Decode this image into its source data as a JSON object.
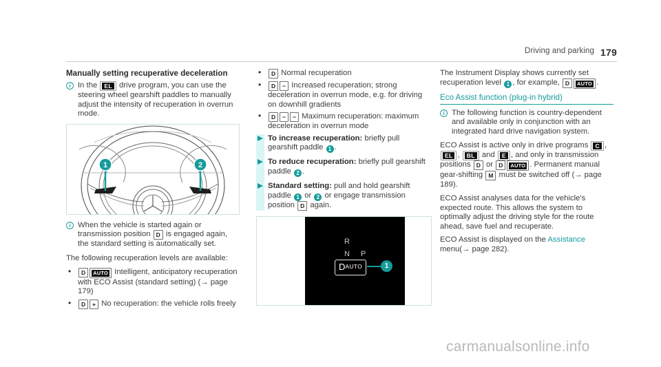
{
  "header": {
    "section_title": "Driving and parking",
    "page_number": "179"
  },
  "left_column": {
    "title": "Manually setting recuperative deceleration",
    "note1_prefix": "In the",
    "note1_badge": "EL",
    "note1_suffix": "drive program, you can use the steering wheel gearshift paddles to manually adjust the intensity of recuperation in overrun mode.",
    "figure_wheel": {
      "callout_1": "1",
      "callout_2": "2",
      "caption": "steering-wheel-gearshift-paddles"
    },
    "note2_prefix": "When the vehicle is started again or transmission position",
    "note2_badge": "D",
    "note2_suffix": "is engaged again, the standard setting is automatically set.",
    "levels_intro": "The following recuperation levels are available:",
    "level_items": [
      {
        "badge1": "D",
        "badge2": "AUTO",
        "text": "Intelligent, anticipatory recuperation with ECO Assist (standard setting)",
        "reference": "(→ page 179)"
      },
      {
        "badge1": "D",
        "badge2": "+",
        "text": "No recuperation: the vehicle rolls freely"
      }
    ]
  },
  "middle_column": {
    "level_items": [
      {
        "badges": [
          "D"
        ],
        "text": "Normal recuperation"
      },
      {
        "badges": [
          "D",
          "−"
        ],
        "text": "Increased recuperation; strong deceleration in overrun mode, e.g. for driving on downhill gradients"
      },
      {
        "badges": [
          "D",
          "−",
          "−"
        ],
        "text": "Maximum recuperation: maximum deceleration in overrun mode"
      }
    ],
    "actions": [
      {
        "lead": "To increase recuperation:",
        "text_before": " briefly pull gearshift paddle ",
        "callout": "1",
        "text_after": "."
      },
      {
        "lead": "To reduce recuperation:",
        "text_before": " briefly pull gearshift paddle ",
        "callout": "2",
        "text_after": "."
      },
      {
        "lead": "Standard setting:",
        "text_before": " pull and hold gearshift paddle ",
        "callout": "1",
        "text_mid": " or ",
        "callout2": "2",
        "text_after2": " or engage transmission position ",
        "badge": "D",
        "text_end": " again."
      }
    ],
    "figure_display": {
      "gear_r": "R",
      "gear_n": "N",
      "gear_p": "P",
      "selected_d": "D",
      "selected_auto": "AUTO",
      "callout_1": "1"
    }
  },
  "right_column": {
    "intro_before": "The Instrument Display shows currently set recuperation level ",
    "intro_callout": "1",
    "intro_middle": ", for example, ",
    "intro_badge1": "D",
    "intro_badge2": "AUTO",
    "intro_end": ".",
    "heading": "Eco Assist function (plug-in hybrid)",
    "note_text": "The following function is country-dependent and available only in conjunction with an integrated hard drive navigation system.",
    "para2_a": "ECO Assist is active only in drive programs ",
    "prog_c": "C",
    "para2_b": ", ",
    "prog_el": "EL",
    "para2_c": ", ",
    "prog_bl": "BL",
    "para2_d": " and ",
    "prog_e": "E",
    "para2_e": ", and only in transmission positions ",
    "pos_d": "D",
    "para2_f": " or ",
    "pos_d2": "D",
    "pos_auto": "AUTO",
    "para2_g": ". Permanent manual gear-shifting ",
    "pos_m": "M",
    "para2_h": " must be switched off (→ page 189).",
    "para3": "ECO Assist analyses data for the vehicle's expected route. This allows the system to optimally adjust the driving style for the route ahead, save fuel and recuperate.",
    "para4_a": "ECO Assist is displayed on the ",
    "para4_link": "Assistance",
    "para4_b": " menu(→ page 282)."
  },
  "watermark": "carmanualsonline.info",
  "colors": {
    "teal": "#169b9b",
    "band": "#d8f6f6",
    "text": "#3d3d3d",
    "heading": "#2b2b2b"
  }
}
